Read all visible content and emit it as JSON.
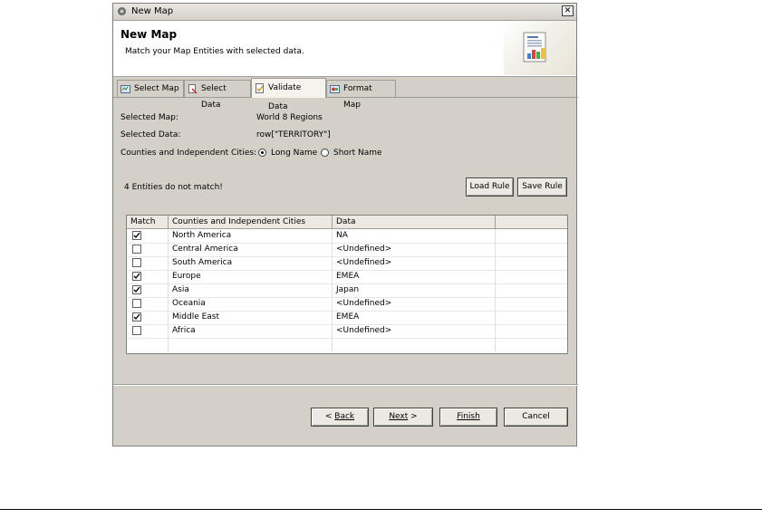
{
  "window": {
    "title": "New Map",
    "close_glyph": "✕"
  },
  "header": {
    "title": "New Map",
    "description": "Match your Map Entities with selected data.",
    "icon": "chart-document-icon"
  },
  "tabs": [
    {
      "label": "Select Map",
      "icon": "map-icon",
      "active": false
    },
    {
      "label": "Select Data",
      "icon": "data-icon",
      "active": false
    },
    {
      "label": "Validate Data",
      "icon": "validate-icon",
      "active": true
    },
    {
      "label": "Format Map",
      "icon": "format-icon",
      "active": false
    }
  ],
  "fields": {
    "selected_map_label": "Selected Map:",
    "selected_map_value": "World 8 Regions",
    "selected_data_label": "Selected Data:",
    "selected_data_value": "row[\"TERRITORY\"]",
    "name_type_label": "Counties and Independent Cities:",
    "long_name": "Long Name",
    "short_name": "Short Name",
    "selected_option": "Long Name"
  },
  "status": {
    "message": "4 Entities do not match!"
  },
  "rule_buttons": {
    "load": "Load Rule",
    "save": "Save Rule"
  },
  "table": {
    "headers": [
      "Match",
      "Counties and Independent Cities",
      "Data",
      ""
    ],
    "rows": [
      {
        "match": true,
        "name": "North America",
        "data": "NA"
      },
      {
        "match": false,
        "name": "Central America",
        "data": "<Undefined>"
      },
      {
        "match": false,
        "name": "South America",
        "data": "<Undefined>"
      },
      {
        "match": true,
        "name": "Europe",
        "data": "EMEA"
      },
      {
        "match": true,
        "name": "Asia",
        "data": "Japan"
      },
      {
        "match": false,
        "name": "Oceania",
        "data": "<Undefined>"
      },
      {
        "match": true,
        "name": "Middle East",
        "data": "EMEA"
      },
      {
        "match": false,
        "name": "Africa",
        "data": "<Undefined>"
      }
    ]
  },
  "nav": {
    "back": "Back",
    "next": "Next",
    "finish": "Finish",
    "cancel": "Cancel"
  },
  "colors": {
    "window_bg": "#d4d0c8",
    "header_bg": "#ffffff",
    "active_tab": "#f4f3ee"
  }
}
